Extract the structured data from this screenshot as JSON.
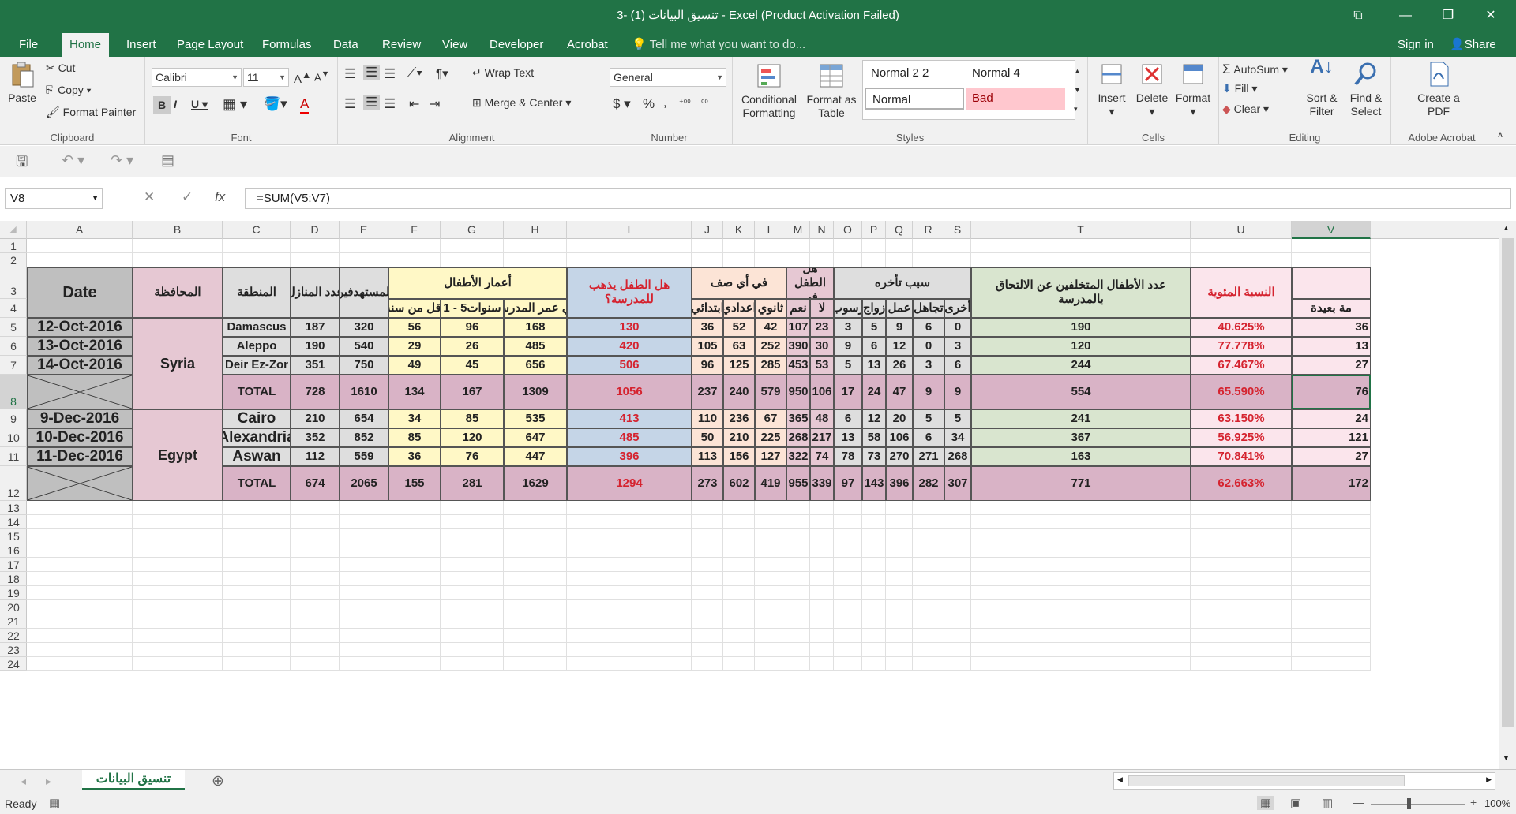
{
  "window": {
    "title": "3- تنسيق البيانات (1) - Excel (Product Activation Failed)"
  },
  "tabs": [
    "File",
    "Home",
    "Insert",
    "Page Layout",
    "Formulas",
    "Data",
    "Review",
    "View",
    "Developer",
    "Acrobat"
  ],
  "tellme": "Tell me what you want to do...",
  "signin": "Sign in",
  "share": "Share",
  "ribbon": {
    "clipboard": {
      "label": "Clipboard",
      "paste": "Paste",
      "cut": "Cut",
      "copy": "Copy",
      "format_painter": "Format Painter"
    },
    "font": {
      "label": "Font",
      "name": "Calibri",
      "size": "11"
    },
    "alignment": {
      "label": "Alignment",
      "wrap": "Wrap Text",
      "merge": "Merge & Center"
    },
    "number": {
      "label": "Number",
      "format": "General"
    },
    "styles": {
      "label": "Styles",
      "conditional": "Conditional Formatting",
      "format_table": "Format as Table",
      "s1": "Normal 2 2",
      "s2": "Normal 4",
      "s3": "Normal",
      "s4": "Bad"
    },
    "cells": {
      "label": "Cells",
      "insert": "Insert",
      "delete": "Delete",
      "format": "Format"
    },
    "editing": {
      "label": "Editing",
      "autosum": "AutoSum",
      "fill": "Fill",
      "clear": "Clear",
      "sort": "Sort & Filter",
      "find": "Find & Select"
    },
    "acrobat": {
      "label": "Adobe Acrobat",
      "create": "Create a PDF"
    }
  },
  "namebox": "V8",
  "formula": "=SUM(V5:V7)",
  "columns": [
    "A",
    "B",
    "C",
    "D",
    "E",
    "F",
    "G",
    "H",
    "I",
    "J",
    "K",
    "L",
    "M",
    "N",
    "O",
    "P",
    "Q",
    "R",
    "S",
    "T",
    "U",
    "V"
  ],
  "rows": [
    "1",
    "2",
    "3",
    "4",
    "5",
    "6",
    "7",
    "8",
    "9",
    "10",
    "11",
    "12",
    "13",
    "14",
    "15",
    "16",
    "17",
    "18",
    "19",
    "20",
    "21",
    "22",
    "23",
    "24"
  ],
  "headers": {
    "date": "Date",
    "gov": "المحافظة",
    "region": "المنطقة",
    "homes": "عدد المنازل",
    "beneficiaries": "المستهدفين",
    "ages": "أعمار الأطفال",
    "age_under1": "أقل من سنة",
    "age_1_5": "1 - 5سنوات",
    "age_school": "في عمر المدرسة",
    "goes_school": "هل الطفل يذهب للمدرسة؟",
    "which_grade": "في أي صف",
    "primary": "ابتدائي",
    "prep": "اعدادي",
    "secondary": "ثانوي",
    "child_in": "هل الطفل في",
    "yes": "نعم",
    "no": "لا",
    "reason": "سبب تأخره",
    "fail": "رسوب",
    "marriage": "زواج",
    "work": "عمل",
    "ignorance": "تجاهل",
    "other": "أخرى",
    "late_count": "عدد الأطفال المتخلفين عن الالتحاق بالمدرسة",
    "percent": "النسبة المئوية",
    "far": "مة بعيدة"
  },
  "table": [
    {
      "date": "12-Oct-2016",
      "region": "Damascus",
      "D": "187",
      "E": "320",
      "F": "56",
      "G": "96",
      "H": "168",
      "I": "130",
      "J": "36",
      "K": "52",
      "L": "42",
      "M": "107",
      "N": "23",
      "O": "3",
      "P": "5",
      "Q": "9",
      "R": "6",
      "S": "0",
      "T": "190",
      "U": "40.625%",
      "V": "36"
    },
    {
      "date": "13-Oct-2016",
      "region": "Aleppo",
      "D": "190",
      "E": "540",
      "F": "29",
      "G": "26",
      "H": "485",
      "I": "420",
      "J": "105",
      "K": "63",
      "L": "252",
      "M": "390",
      "N": "30",
      "O": "9",
      "P": "6",
      "Q": "12",
      "R": "0",
      "S": "3",
      "T": "120",
      "U": "77.778%",
      "V": "13"
    },
    {
      "date": "14-Oct-2016",
      "region": "Deir Ez-Zor",
      "D": "351",
      "E": "750",
      "F": "49",
      "G": "45",
      "H": "656",
      "I": "506",
      "J": "96",
      "K": "125",
      "L": "285",
      "M": "453",
      "N": "53",
      "O": "5",
      "P": "13",
      "Q": "26",
      "R": "3",
      "S": "6",
      "T": "244",
      "U": "67.467%",
      "V": "27"
    },
    {
      "date": "",
      "region": "TOTAL",
      "D": "728",
      "E": "1610",
      "F": "134",
      "G": "167",
      "H": "1309",
      "I": "1056",
      "J": "237",
      "K": "240",
      "L": "579",
      "M": "950",
      "N": "106",
      "O": "17",
      "P": "24",
      "Q": "47",
      "R": "9",
      "S": "9",
      "T": "554",
      "U": "65.590%",
      "V": "76"
    },
    {
      "date": "9-Dec-2016",
      "region": "Cairo",
      "D": "210",
      "E": "654",
      "F": "34",
      "G": "85",
      "H": "535",
      "I": "413",
      "J": "110",
      "K": "236",
      "L": "67",
      "M": "365",
      "N": "48",
      "O": "6",
      "P": "12",
      "Q": "20",
      "R": "5",
      "S": "5",
      "T": "241",
      "U": "63.150%",
      "V": "24"
    },
    {
      "date": "10-Dec-2016",
      "region": "Alexandria",
      "D": "352",
      "E": "852",
      "F": "85",
      "G": "120",
      "H": "647",
      "I": "485",
      "J": "50",
      "K": "210",
      "L": "225",
      "M": "268",
      "N": "217",
      "O": "13",
      "P": "58",
      "Q": "106",
      "R": "6",
      "S": "34",
      "T": "367",
      "U": "56.925%",
      "V": "121"
    },
    {
      "date": "11-Dec-2016",
      "region": "Aswan",
      "D": "112",
      "E": "559",
      "F": "36",
      "G": "76",
      "H": "447",
      "I": "396",
      "J": "113",
      "K": "156",
      "L": "127",
      "M": "322",
      "N": "74",
      "O": "78",
      "P": "73",
      "Q": "270",
      "R": "271",
      "S": "268",
      "T": "163",
      "U": "70.841%",
      "V": "27"
    },
    {
      "date": "",
      "region": "TOTAL",
      "D": "674",
      "E": "2065",
      "F": "155",
      "G": "281",
      "H": "1629",
      "I": "1294",
      "J": "273",
      "K": "602",
      "L": "419",
      "M": "955",
      "N": "339",
      "O": "97",
      "P": "143",
      "Q": "396",
      "R": "282",
      "S": "307",
      "T": "771",
      "U": "62.663%",
      "V": "172"
    }
  ],
  "govs": [
    "Syria",
    "Egypt"
  ],
  "sheet_tab": "تنسيق البيانات",
  "status": {
    "ready": "Ready",
    "zoom": "100%"
  },
  "colors": {
    "green": "#217346",
    "gray": "#bfbfbf",
    "pink": "#e6c8d3",
    "yellow": "#fff8c6",
    "blue": "#c5d5e7",
    "peach": "#fce4d6",
    "lightgray": "#dedede",
    "lightgreen": "#d9e5cf",
    "lightpink": "#fbe5ec",
    "total": "#d9b3c6",
    "red": "#d5232f"
  }
}
